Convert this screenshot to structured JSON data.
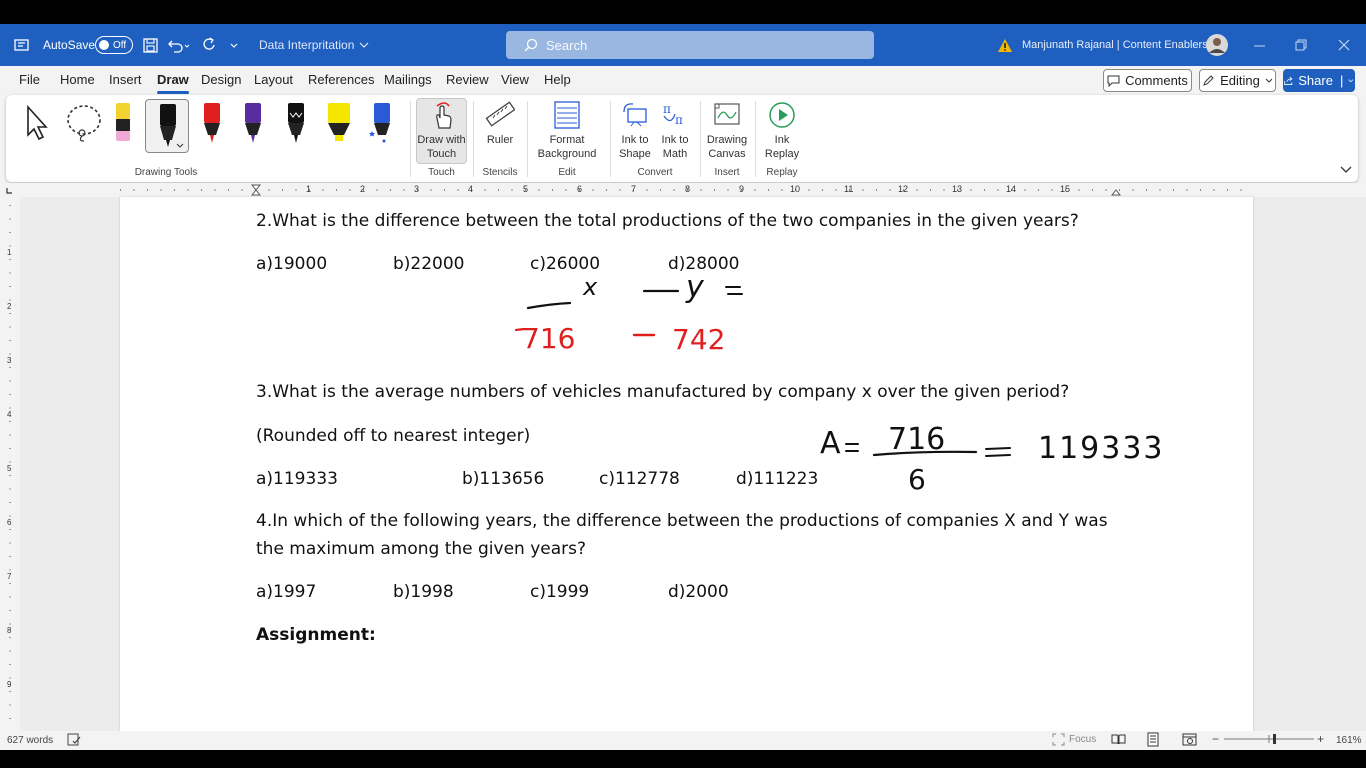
{
  "window": {
    "autosave_label": "AutoSave",
    "autosave_state": "Off",
    "doc_title": "Data Interpritation",
    "search_placeholder": "Search",
    "user_name": "Manjunath Rajanal | Content Enablers"
  },
  "menu": {
    "tabs": [
      "File",
      "Home",
      "Insert",
      "Draw",
      "Design",
      "Layout",
      "References",
      "Mailings",
      "Review",
      "View",
      "Help"
    ],
    "active_tab": "Draw",
    "comments_label": "Comments",
    "editing_label": "Editing",
    "share_label": "Share"
  },
  "ribbon": {
    "groups": {
      "drawing_tools": "Drawing Tools",
      "touch": "Touch",
      "stencils": "Stencils",
      "edit": "Edit",
      "convert": "Convert",
      "insert": "Insert",
      "replay": "Replay"
    },
    "buttons": {
      "draw_with_touch_1": "Draw with",
      "draw_with_touch_2": "Touch",
      "ruler": "Ruler",
      "format_bg_1": "Format",
      "format_bg_2": "Background",
      "ink_shape_1": "Ink to",
      "ink_shape_2": "Shape",
      "ink_math_1": "Ink to",
      "ink_math_2": "Math",
      "canvas_1": "Drawing",
      "canvas_2": "Canvas",
      "replay_1": "Ink",
      "replay_2": "Replay"
    },
    "pen_colors": [
      "#f2d230",
      "#111111",
      "#e02020",
      "#5a2ca0",
      "#111111",
      "#f5e600",
      "#2a5bd7"
    ]
  },
  "ruler": {
    "marks": [
      "1",
      "2",
      "3",
      "4",
      "5",
      "6",
      "7",
      "8",
      "9",
      "10",
      "11",
      "12",
      "13",
      "14",
      "15"
    ],
    "vmarks": [
      "1",
      "2",
      "3",
      "4",
      "5",
      "6",
      "7",
      "8",
      "9"
    ]
  },
  "document": {
    "q2": "2.What is the difference between the total productions of the two companies in the given years?",
    "q2_a": "a)19000",
    "q2_b": "b)22000",
    "q2_c": "c)26000",
    "q2_d": "d)28000",
    "q3": "3.What is the average numbers of vehicles manufactured by company x over the given period?",
    "q3_note": "(Rounded off to nearest integer)",
    "q3_a": "a)119333",
    "q3_b": "b)113656",
    "q3_c": "c)112778",
    "q3_d": "d)111223",
    "q4_line1": "4.In which of the following years, the difference between the productions of companies X and Y was",
    "q4_line2": "the maximum among the given years?",
    "q4_a": "a)1997",
    "q4_b": "b)1998",
    "q4_c": "c)1999",
    "q4_d": "d)2000",
    "assignment": "Assignment:"
  },
  "ink_text": {
    "x_label": "x",
    "y_label": "y",
    "x_total": "716",
    "y_total": "742",
    "avg_label": "A",
    "avg_numerator": "716",
    "avg_denominator": "6",
    "avg_result": "119333"
  },
  "status": {
    "word_count": "627 words",
    "focus": "Focus",
    "zoom": "161%"
  }
}
